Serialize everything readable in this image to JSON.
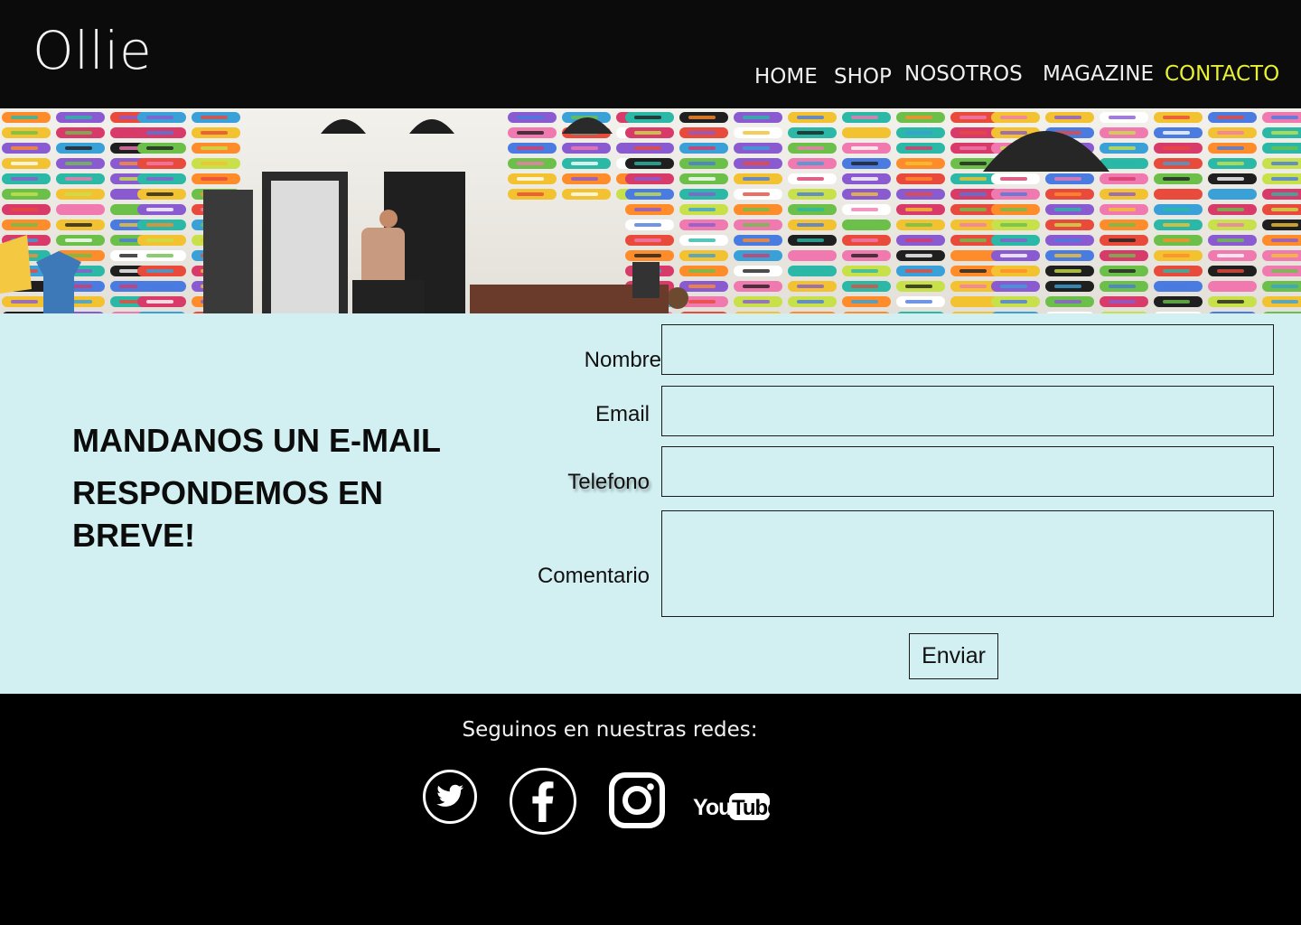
{
  "brand": {
    "logo": "Ollie"
  },
  "nav": {
    "items": [
      {
        "label": "HOME"
      },
      {
        "label": "SHOP"
      },
      {
        "label": "NOSOTROS"
      },
      {
        "label": "MAGAZINE"
      },
      {
        "label": "CONTACTO",
        "active": true
      }
    ],
    "active_color": "#e8f033"
  },
  "contact": {
    "headline_line1": "MANDANOS UN E-MAIL",
    "headline_line2": "RESPONDEMOS EN BREVE!",
    "form": {
      "name_label": "Nombre",
      "email_label": "Email",
      "phone_label": "Telefono",
      "comment_label": "Comentario",
      "name_value": "",
      "email_value": "",
      "phone_value": "",
      "comment_value": "",
      "submit_label": "Enviar"
    },
    "background_color": "#d2f0f2"
  },
  "footer": {
    "follow_text": "Seguinos en nuestras redes:",
    "social": [
      {
        "name": "twitter-icon"
      },
      {
        "name": "facebook-icon"
      },
      {
        "name": "instagram-icon"
      },
      {
        "name": "youtube-icon",
        "wordmark": "YouTube"
      }
    ]
  },
  "hero": {
    "image": "skateboard-shop-wall"
  }
}
